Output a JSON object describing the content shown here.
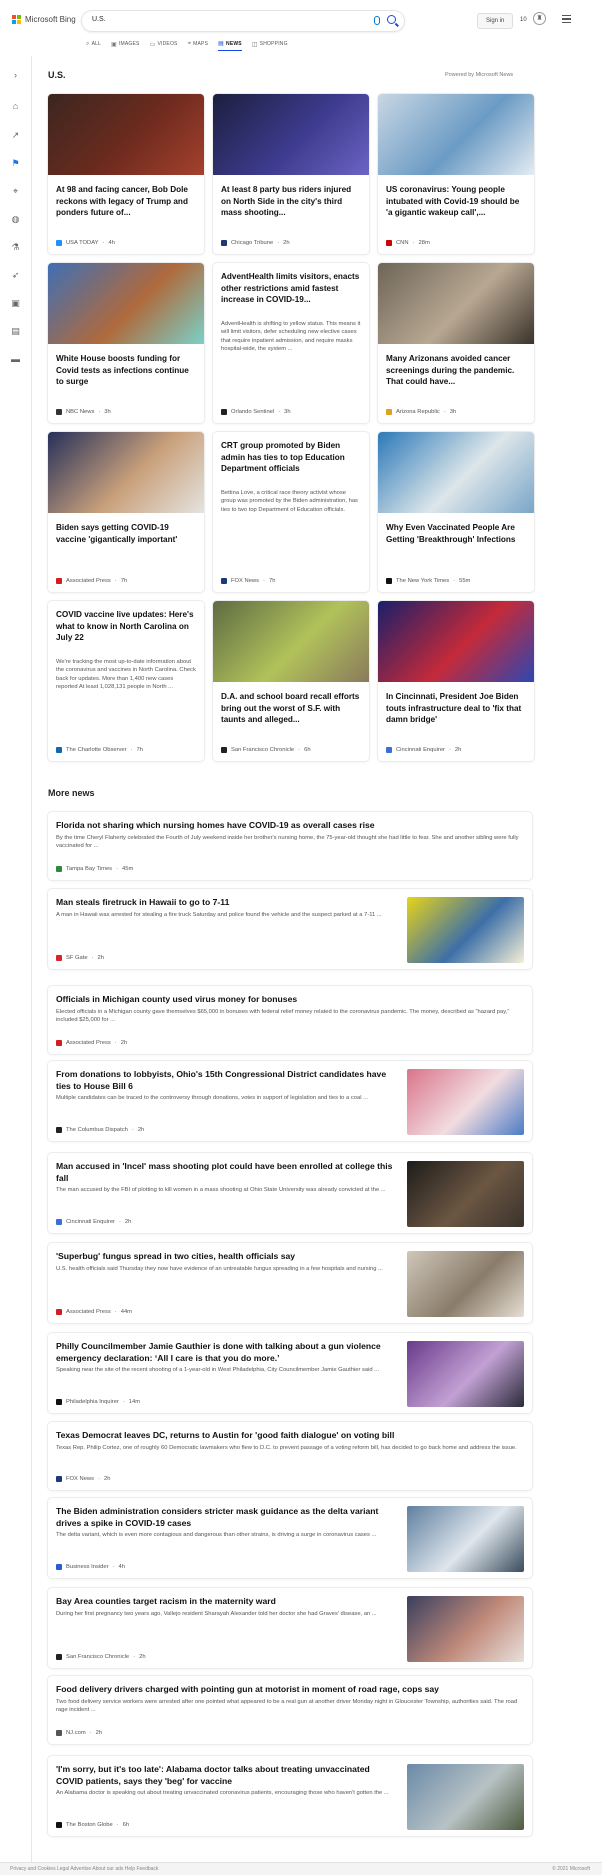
{
  "header": {
    "logo_text": "Microsoft Bing",
    "query": "U.S.",
    "signin_label": "Sign in",
    "rewards_count": "10"
  },
  "scopes": [
    {
      "label": "ALL",
      "glyph": "⌕"
    },
    {
      "label": "IMAGES",
      "glyph": "▣"
    },
    {
      "label": "VIDEOS",
      "glyph": "▭"
    },
    {
      "label": "MAPS",
      "glyph": "⌖"
    },
    {
      "label": "NEWS",
      "glyph": "▤"
    },
    {
      "label": "SHOPPING",
      "glyph": "◫"
    }
  ],
  "main": {
    "title": "U.S.",
    "powered_by": "Powered by Microsoft News",
    "more_title": "More news"
  },
  "colors": {
    "accent": "#174ae4",
    "brand_red": "#f25022",
    "brand_green": "#7fba00",
    "brand_blue": "#00a4ef",
    "brand_yellow": "#ffb900"
  },
  "cards": [
    {
      "title": "At 98 and facing cancer, Bob Dole reckons with legacy of Trump and ponders future of...",
      "desc": "",
      "source": "USA TODAY",
      "time": "4h",
      "has_image": true,
      "img_colors": [
        "#3b2620",
        "#6e2b1e",
        "#a5412e"
      ],
      "logo_color": "#1e90ff"
    },
    {
      "title": "At least 8 party bus riders injured on North Side in the city's third mass shooting...",
      "desc": "",
      "source": "Chicago Tribune",
      "time": "2h",
      "has_image": true,
      "img_colors": [
        "#1c1f3f",
        "#3d3b8e",
        "#6b64c4"
      ],
      "logo_color": "#1a3b6e"
    },
    {
      "title": "US coronavirus: Young people intubated with Covid-19 should be 'a gigantic wakeup call',...",
      "desc": "",
      "source": "CNN",
      "time": "28m",
      "has_image": true,
      "img_colors": [
        "#c8d7e4",
        "#6b9bc4",
        "#e4ecf2"
      ],
      "logo_color": "#cc0000"
    },
    {
      "title": "White House boosts funding for Covid tests as infections continue to surge",
      "desc": "",
      "source": "NBC News",
      "time": "3h",
      "has_image": true,
      "img_colors": [
        "#3f6fb4",
        "#b06a3c",
        "#7ad1c8"
      ],
      "logo_color": "#333"
    },
    {
      "title": "AdventHealth limits visitors, enacts other restrictions amid fastest increase in COVID-19...",
      "desc": "AdventHealth is shifting to yellow status. This means it will limit visitors, defer scheduling new elective cases that require inpatient admission, and require masks hospital-wide, the system ...",
      "source": "Orlando Sentinel",
      "time": "3h",
      "has_image": false,
      "logo_color": "#222"
    },
    {
      "title": "Many Arizonans avoided cancer screenings during the pandemic. That could have...",
      "desc": "",
      "source": "Arizona Republic",
      "time": "3h",
      "has_image": true,
      "img_colors": [
        "#6d6558",
        "#b8a892",
        "#3a332b"
      ],
      "logo_color": "#e0a020"
    },
    {
      "title": "Biden says getting COVID-19 vaccine 'gigantically important'",
      "desc": "",
      "source": "Associated Press",
      "time": "7h",
      "has_image": true,
      "img_colors": [
        "#26305a",
        "#c9a07b",
        "#e4e3e0"
      ],
      "logo_color": "#d21e1e"
    },
    {
      "title": "CRT group promoted by Biden admin has ties to top Education Department officials",
      "desc": "Bettina Love, a critical race theory activist whose group was promoted by the Biden administration, has ties to two top Department of Education officials.",
      "source": "FOX News",
      "time": "7h",
      "has_image": false,
      "logo_color": "#1b3a7a"
    },
    {
      "title": "Why Even Vaccinated People Are Getting 'Breakthrough' Infections",
      "desc": "",
      "source": "The New York Times",
      "time": "55m",
      "has_image": true,
      "img_colors": [
        "#2c79b8",
        "#dde6ea",
        "#7aa6c8"
      ],
      "logo_color": "#111"
    },
    {
      "title": "COVID vaccine live updates: Here's what to know in North Carolina on July 22",
      "desc": "We're tracking the most up-to-date information about the coronavirus and vaccines in North Carolina. Check back for updates. More than 1,400 new cases reported At least 1,028,131 people in North ...",
      "source": "The Charlotte Observer",
      "time": "7h",
      "has_image": false,
      "logo_color": "#1566b0"
    },
    {
      "title": "D.A. and school board recall efforts bring out the worst of S.F. with taunts and alleged...",
      "desc": "",
      "source": "San Francisco Chronicle",
      "time": "6h",
      "has_image": true,
      "img_colors": [
        "#5e6b43",
        "#b1c25a",
        "#8a7a5c"
      ],
      "logo_color": "#222"
    },
    {
      "title": "In Cincinnati, President Joe Biden touts infrastructure deal to 'fix that damn bridge'",
      "desc": "",
      "source": "Cincinnati Enquirer",
      "time": "2h",
      "has_image": true,
      "img_colors": [
        "#1a1f6a",
        "#c42a3a",
        "#2e47b0"
      ],
      "logo_color": "#3a6fd8"
    }
  ],
  "more_news": [
    {
      "title": "Florida not sharing which nursing homes have COVID-19 as overall cases rise",
      "snippet": "By the time Cheryl Flaherty celebrated the Fourth of July weekend inside her brother's nursing home, the 75-year-old thought she had little to fear. She and another sibling were fully vaccinated for ...",
      "source": "Tampa Bay Times",
      "time": "45m",
      "has_image": false,
      "logo_color": "#2b8a3e"
    },
    {
      "title": "Man steals firetruck in Hawaii to go to 7-11",
      "snippet": "A man in Hawaii was arrested for stealing a fire truck Saturday and police found the vehicle and the suspect parked at a 7-11 ...",
      "source": "SF Gate",
      "time": "2h",
      "has_image": true,
      "img_colors": [
        "#e8d418",
        "#3d6fa8",
        "#f5f0d6"
      ],
      "logo_color": "#d8242f"
    },
    {
      "title": "Officials in Michigan county used virus money for bonuses",
      "snippet": "Elected officials in a Michigan county gave themselves $65,000 in bonuses with federal relief money related to the coronavirus pandemic. The money, described as “hazard pay,” included $25,000 for ...",
      "source": "Associated Press",
      "time": "2h",
      "has_image": false,
      "logo_color": "#d21e1e"
    },
    {
      "title": "From donations to lobbyists, Ohio's 15th Congressional District candidates have ties to House Bill 6",
      "snippet": "Multiple candidates can be traced to the controversy through donations, votes in support of legislation and ties to a coal ...",
      "source": "The Columbus Dispatch",
      "time": "2h",
      "has_image": true,
      "img_colors": [
        "#d9748a",
        "#f2dce0",
        "#4c7bc4"
      ],
      "logo_color": "#222"
    },
    {
      "title": "Man accused in 'Incel' mass shooting plot could have been enrolled at college this fall",
      "snippet": "The man accused by the FBI of plotting to kill women in a mass shooting at Ohio State University was already convicted at the ...",
      "source": "Cincinnati Enquirer",
      "time": "2h",
      "has_image": true,
      "img_colors": [
        "#1e1c1a",
        "#6b5642",
        "#3a332d"
      ],
      "logo_color": "#3a6fd8"
    },
    {
      "title": "'Superbug' fungus spread in two cities, health officials say",
      "snippet": "U.S. health officials said Thursday they now have evidence of an untreatable fungus spreading in a few hospitals and nursing ...",
      "source": "Associated Press",
      "time": "44m",
      "has_image": true,
      "img_colors": [
        "#cfc7ba",
        "#8a7c6a",
        "#e6dfd4"
      ],
      "logo_color": "#d21e1e"
    },
    {
      "title": "Philly Councilmember Jamie Gauthier is done with talking about a gun violence emergency declaration: ‘All I care is that you do more.’",
      "snippet": "Speaking near the site of the recent shooting of a 1-year-old in West Philadelphia, City Councilmember Jamie Gauthier said ...",
      "source": "Philadelphia Inquirer",
      "time": "14m",
      "has_image": true,
      "img_colors": [
        "#6a3a8a",
        "#c2a1d4",
        "#2b2a3a"
      ],
      "logo_color": "#111"
    },
    {
      "title": "Texas Democrat leaves DC, returns to Austin for 'good faith dialogue' on voting bill",
      "snippet": "Texas Rep. Philip Cortez, one of roughly 60 Democratic lawmakers who flew to D.C. to prevent passage of a voting reform bill, has decided to go back home and address the issue.",
      "source": "FOX News",
      "time": "2h",
      "has_image": false,
      "logo_color": "#1b3a7a"
    },
    {
      "title": "The Biden administration considers stricter mask guidance as the delta variant drives a spike in COVID-19 cases",
      "snippet": "The delta variant, which is even more contagious and dangerous than other strains, is driving a surge in coronavirus cases ...",
      "source": "Business Insider",
      "time": "4h",
      "has_image": true,
      "img_colors": [
        "#5f7f9f",
        "#dfe6ec",
        "#3a4c5d"
      ],
      "logo_color": "#2a5bd8"
    },
    {
      "title": "Bay Area counties target racism in the maternity ward",
      "snippet": "During her first pregnancy two years ago, Vallejo resident Sharayah Alexander told her doctor she had Graves' disease, an ...",
      "source": "San Francisco Chronicle",
      "time": "2h",
      "has_image": true,
      "img_colors": [
        "#3a3f5e",
        "#c08a7a",
        "#e8e1dc"
      ],
      "logo_color": "#222"
    },
    {
      "title": "Food delivery drivers charged with pointing gun at motorist in moment of road rage, cops say",
      "snippet": "Two food delivery service workers were arrested after one pointed what appeared to be a real gun at another driver Monday night in Gloucester Township, authorities said. The road rage incident ...",
      "source": "NJ.com",
      "time": "2h",
      "has_image": false,
      "logo_color": "#555"
    },
    {
      "title": "'I'm sorry, but it's too late': Alabama doctor talks about treating unvaccinated COVID patients, says they 'beg' for vaccine",
      "snippet": "An Alabama doctor is speaking out about treating unvaccinated coronavirus patients, encouraging those who haven't gotten the ...",
      "source": "The Boston Globe",
      "time": "6h",
      "has_image": true,
      "img_colors": [
        "#6b8aa8",
        "#b7c2c4",
        "#4e5b3f"
      ],
      "logo_color": "#111"
    }
  ],
  "footer": {
    "left": "Privacy and Cookies   Legal   Advertise   About our ads   Help   Feedback",
    "right": "© 2021 Microsoft"
  }
}
